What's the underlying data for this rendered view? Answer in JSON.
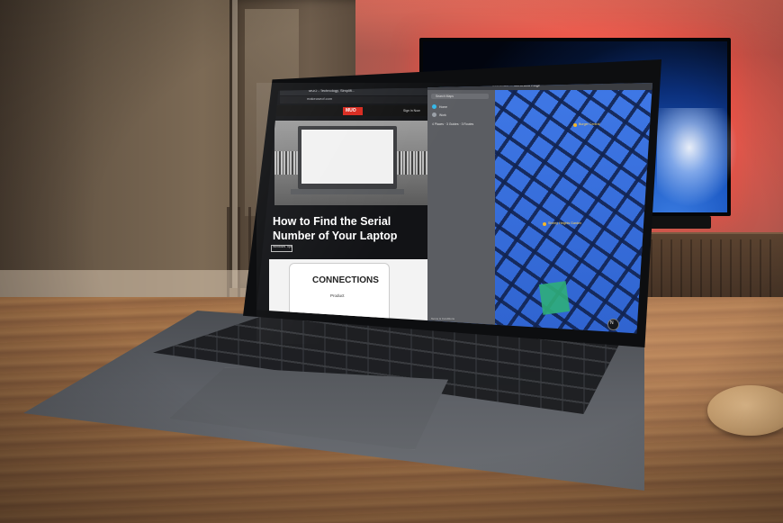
{
  "left_window": {
    "tab_title": "MUO - Technology, Simplifi...",
    "url": "makeuseof.com",
    "logo": "MUO",
    "sign_in": "Sign in Now",
    "headline": "How to Find the Serial Number of Your Laptop",
    "tag": "Windows Tips",
    "card_title": "CONNECTIONS",
    "card_subtitle": "Product"
  },
  "right_window": {
    "window_title": "Boardwalk — Sutherland Ridge",
    "search_placeholder": "Search Maps",
    "sidebar_items": [
      "Home",
      "Work"
    ],
    "sidebar_summary": "4 Places · 3 Guides · 3 Routes",
    "poi_labels": [
      "Burger Central",
      "Shirley Heights Garden"
    ],
    "compass": "N",
    "bottom_text": "Terms & Conditions"
  },
  "colors": {
    "wall_glow": "#ff6a5c",
    "tv_blue": "#1a57c2",
    "map_blue": "#3f78e6",
    "muo_red": "#d8271c",
    "park_green": "#2fae7a"
  }
}
